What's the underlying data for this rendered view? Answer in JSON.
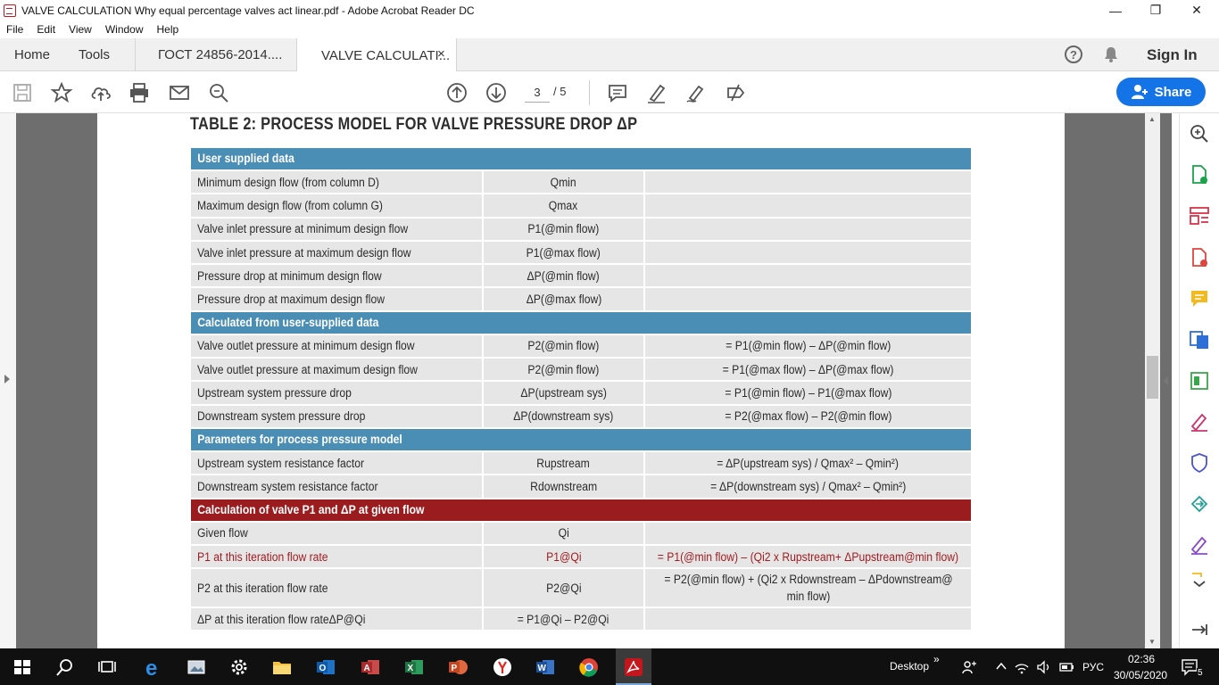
{
  "window": {
    "title": "VALVE CALCULATION Why equal percentage valves act linear.pdf - Adobe Acrobat Reader DC",
    "minimize": "—",
    "maximize": "❐",
    "close": "✕"
  },
  "menu": [
    "File",
    "Edit",
    "View",
    "Window",
    "Help"
  ],
  "tabs": {
    "home": "Home",
    "tools": "Tools",
    "doc1": "ГОСТ 24856-2014....",
    "doc2": "VALVE CALCULATI...",
    "doc2_close": "×",
    "help": "?",
    "signin": "Sign In"
  },
  "toolbar": {
    "page_current": "3",
    "page_total": "/ 5",
    "share": "Share"
  },
  "document": {
    "title": "TABLE 2: PROCESS MODEL FOR VALVE PRESSURE DROP ΔP",
    "sections": [
      {
        "header": "User supplied data",
        "rows": [
          [
            "Minimum design flow (from column D)",
            "Qmin",
            ""
          ],
          [
            "Maximum design flow (from column G)",
            "Qmax",
            ""
          ],
          [
            "Valve inlet pressure at minimum design flow",
            "P1(@min flow)",
            ""
          ],
          [
            "Valve inlet pressure at maximum design flow",
            "P1(@max flow)",
            ""
          ],
          [
            "Pressure drop at minimum design flow",
            "ΔP(@min flow)",
            ""
          ],
          [
            "Pressure drop at maximum design flow",
            "ΔP(@max flow)",
            ""
          ]
        ]
      },
      {
        "header": "Calculated from user-supplied data",
        "rows": [
          [
            "Valve outlet pressure at minimum design flow",
            "P2(@min flow)",
            "= P1(@min flow) – ΔP(@min flow)"
          ],
          [
            "Valve outlet pressure at maximum design flow",
            "P2(@min flow)",
            "= P1(@max flow) – ΔP(@max flow)"
          ],
          [
            "Upstream system pressure drop",
            "ΔP(upstream sys)",
            "= P1(@min flow) – P1(@max flow)"
          ],
          [
            "Downstream system pressure drop",
            "ΔP(downstream sys)",
            "= P2(@max flow) – P2(@min flow)"
          ]
        ]
      },
      {
        "header": "Parameters for process pressure model",
        "rows": [
          [
            "Upstream system resistance factor",
            "Rupstream",
            "= ΔP(upstream sys) / Qmax² – Qmin²)"
          ],
          [
            "Downstream system resistance factor",
            "Rdownstream",
            "= ΔP(downstream sys) / Qmax² – Qmin²)"
          ]
        ]
      },
      {
        "header": "Calculation of valve P1 and ΔP at given flow",
        "rows": [
          [
            "Given flow",
            "Qi",
            ""
          ],
          [
            "P1 at this iteration flow rate",
            "P1@Qi",
            "= P1(@min flow) – (Qi2 x  Rupstream+ ΔPupstream@min flow)"
          ],
          [
            "P2 at this iteration flow rate",
            "P2@Qi",
            "= P2(@min flow) + (Qi2 x  Rdownstream – ΔPdownstream@ min flow)"
          ],
          [
            "ΔP at this iteration flow rateΔP@Qi",
            "= P1@Qi – P2@Qi",
            ""
          ]
        ]
      }
    ]
  },
  "taskbar": {
    "desktop": "Desktop",
    "chevron": "»",
    "lang": "РУС",
    "time": "02:36",
    "date": "30/05/2020",
    "notifications": "5"
  },
  "colors": {
    "section_blue": "#4a8db5",
    "section_red": "#9b1c1f",
    "highlight_text": "#a11d21",
    "share_blue": "#1473e6"
  }
}
